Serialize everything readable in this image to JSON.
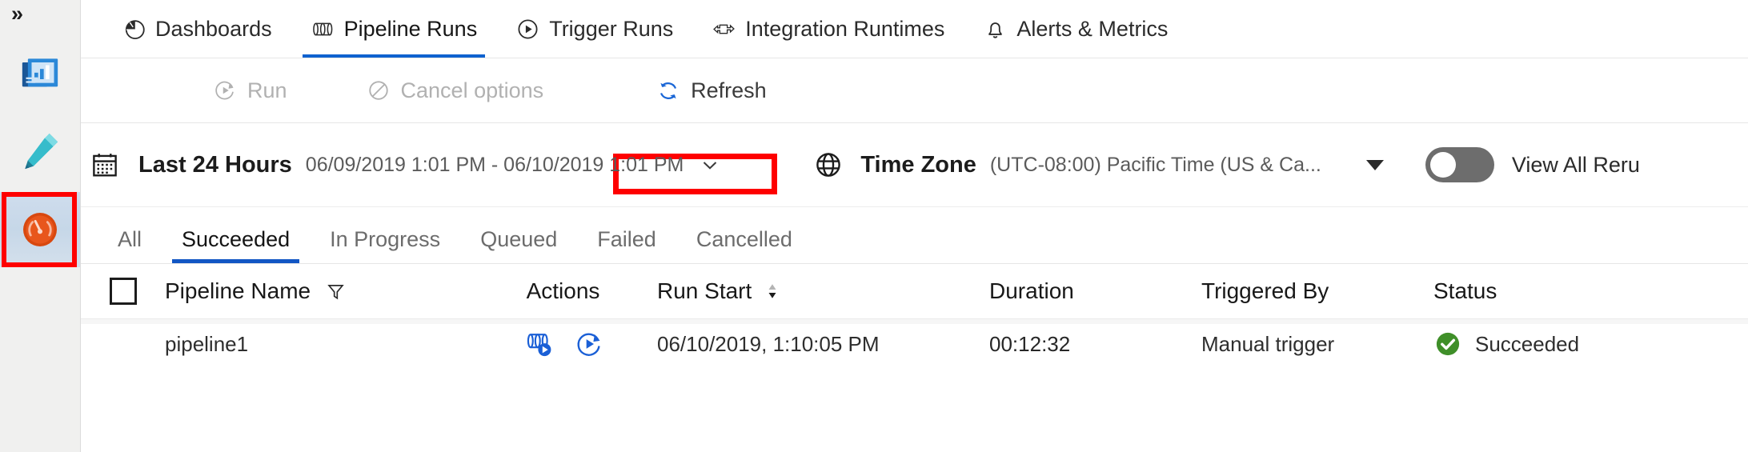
{
  "rail": {
    "expand_label": "»",
    "items": [
      {
        "name": "overview-icon",
        "label": "Overview",
        "selected": false
      },
      {
        "name": "author-pencil-icon",
        "label": "Author",
        "selected": false
      },
      {
        "name": "monitor-gauge-icon",
        "label": "Monitor",
        "selected": true
      }
    ]
  },
  "tabs": [
    {
      "label": "Dashboards",
      "icon": "pie-chart-icon",
      "active": false
    },
    {
      "label": "Pipeline Runs",
      "icon": "pipeline-icon",
      "active": true
    },
    {
      "label": "Trigger Runs",
      "icon": "play-circle-icon",
      "active": false
    },
    {
      "label": "Integration Runtimes",
      "icon": "integration-runtime-icon",
      "active": false
    },
    {
      "label": "Alerts & Metrics",
      "icon": "bell-icon",
      "active": false
    }
  ],
  "toolbar": {
    "run_label": "Run",
    "cancel_label": "Cancel options",
    "refresh_label": "Refresh",
    "run_enabled": false,
    "cancel_enabled": false,
    "highlight_color": "#fe0000"
  },
  "filterbar": {
    "range_label": "Last 24 Hours",
    "range_value": "06/09/2019 1:01 PM - 06/10/2019 1:01 PM",
    "timezone_label": "Time Zone",
    "timezone_value": "(UTC-08:00) Pacific Time (US & Ca...",
    "toggle_label": "View All Reru",
    "toggle_on": false
  },
  "pivots": [
    {
      "label": "All",
      "active": false
    },
    {
      "label": "Succeeded",
      "active": true
    },
    {
      "label": "In Progress",
      "active": false
    },
    {
      "label": "Queued",
      "active": false
    },
    {
      "label": "Failed",
      "active": false
    },
    {
      "label": "Cancelled",
      "active": false
    }
  ],
  "table": {
    "columns": {
      "pipeline_name": "Pipeline Name",
      "actions": "Actions",
      "run_start": "Run Start",
      "duration": "Duration",
      "triggered_by": "Triggered By",
      "status": "Status"
    },
    "sort_column": "Run Start",
    "sort_direction": "descending",
    "rows": [
      {
        "pipeline_name": "pipeline1",
        "actions": [
          "view-activity-runs-icon",
          "rerun-icon"
        ],
        "run_start": "06/10/2019, 1:10:05 PM",
        "duration": "00:12:32",
        "triggered_by": "Manual trigger",
        "status": "Succeeded",
        "status_color": "#3f8f29"
      }
    ]
  },
  "colors": {
    "accent": "#0f62cf",
    "pivot_accent": "#1256c4",
    "action_icon": "#1a5fd6",
    "success": "#3f8f29",
    "highlight": "#fe0000"
  }
}
